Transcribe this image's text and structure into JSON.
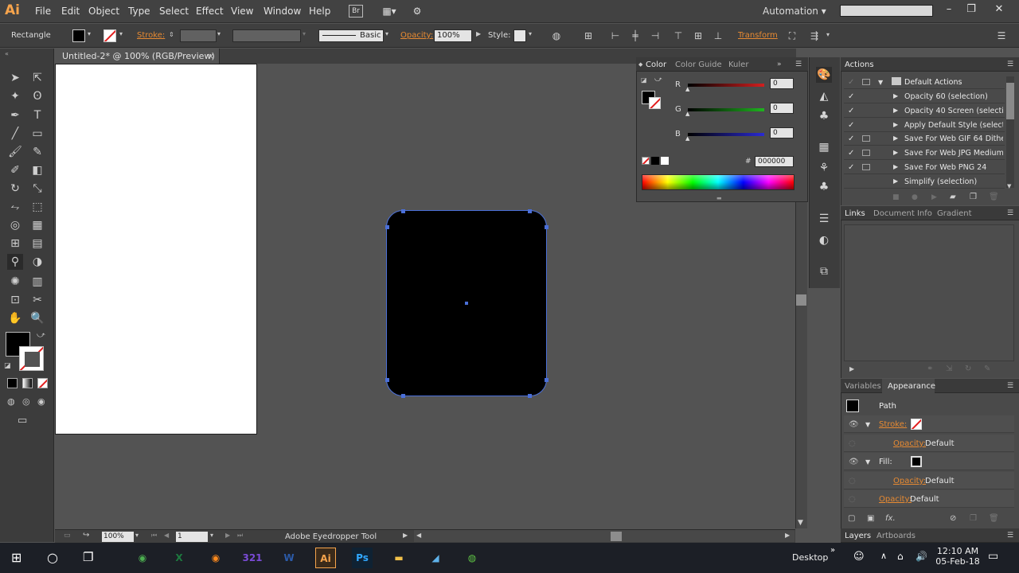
{
  "app": {
    "logo": "Ai",
    "menu": [
      "File",
      "Edit",
      "Object",
      "Type",
      "Select",
      "Effect",
      "View",
      "Window",
      "Help"
    ],
    "bridge_label": "Br",
    "workspace": "Automation",
    "search_placeholder": ""
  },
  "controlbar": {
    "tool_name": "Rectangle",
    "stroke_label": "Stroke:",
    "brush_label": "Basic",
    "opacity_label": "Opacity:",
    "opacity_value": "100%",
    "style_label": "Style:",
    "transform_label": "Transform"
  },
  "document": {
    "tab_title": "Untitled-2* @ 100% (RGB/Preview)",
    "close_glyph": "×"
  },
  "statusbar": {
    "zoom": "100%",
    "artboard": "1",
    "status_text": "Adobe Eyedropper Tool"
  },
  "color_panel": {
    "tabs": [
      "Color",
      "Color Guide",
      "Kuler"
    ],
    "channels": [
      {
        "label": "R",
        "value": "0",
        "color": "#d21f1f"
      },
      {
        "label": "G",
        "value": "0",
        "color": "#1fb41f"
      },
      {
        "label": "B",
        "value": "0",
        "color": "#2a2ad2"
      }
    ],
    "hex_symbol": "#",
    "hex_value": "000000"
  },
  "actions_panel": {
    "tab": "Actions",
    "set_name": "Default Actions",
    "items": [
      "Opacity 60 (selection)",
      "Opacity 40 Screen (selection)",
      "Apply Default Style (selecti...",
      "Save For Web GIF 64 Dithe...",
      "Save For Web JPG Medium",
      "Save For Web PNG 24",
      "Simplify (selection)"
    ]
  },
  "links_panel": {
    "tabs": [
      "Links",
      "Document Info",
      "Gradient"
    ]
  },
  "appearance_panel": {
    "tabs": [
      "Variables",
      "Appearance"
    ],
    "object_type": "Path",
    "stroke_label": "Stroke:",
    "fill_label": "Fill:",
    "opacity_label": "Opacity:",
    "opacity_value": "Default"
  },
  "bottom_tabs": [
    "Layers",
    "Artboards"
  ],
  "taskbar": {
    "desktop_label": "Desktop",
    "time": "12:10 AM",
    "date": "05-Feb-18",
    "apps": [
      {
        "name": "chrome",
        "glyph": "◉",
        "color": "#4caf50"
      },
      {
        "name": "excel",
        "glyph": "X",
        "color": "#1d7a3f"
      },
      {
        "name": "firefox",
        "glyph": "◉",
        "color": "#ff8a1d"
      },
      {
        "name": "media",
        "glyph": "321",
        "color": "#7a4bd6"
      },
      {
        "name": "word",
        "glyph": "W",
        "color": "#2b5aa8"
      },
      {
        "name": "illustrator",
        "glyph": "Ai",
        "color": "#f7a44c"
      },
      {
        "name": "photoshop",
        "glyph": "Ps",
        "color": "#31a8ff"
      },
      {
        "name": "explorer",
        "glyph": "▬",
        "color": "#f2c14a"
      },
      {
        "name": "tool",
        "glyph": "◢",
        "color": "#5fb2ea"
      },
      {
        "name": "globe",
        "glyph": "◍",
        "color": "#5ec244"
      }
    ]
  },
  "colors": {
    "accent": "#e78a32",
    "selection": "#4a6fd8",
    "shape_fill": "#000000"
  }
}
